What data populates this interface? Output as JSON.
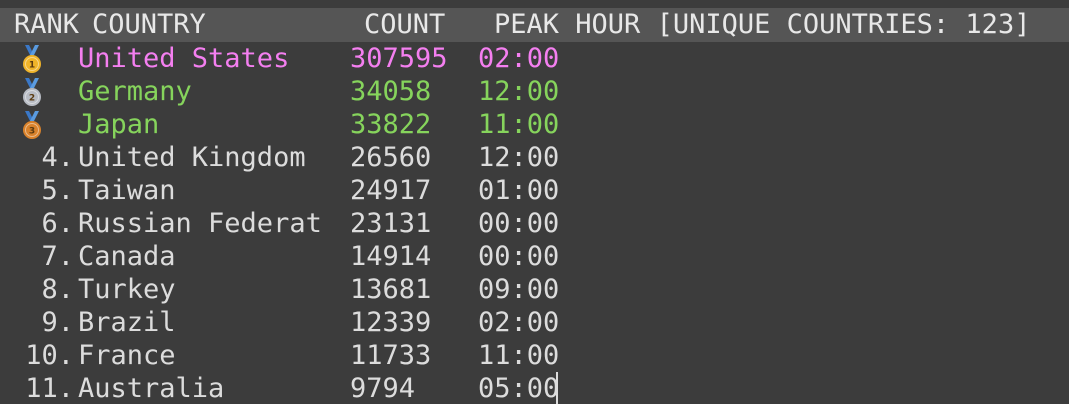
{
  "header": {
    "rank": "RANK",
    "country": "COUNTRY",
    "count": "COUNT",
    "peak_hour": "PEAK HOUR",
    "unique": "[UNIQUE COUNTRIES: 123]"
  },
  "colors": {
    "first_place": "#f47ff0",
    "podium": "#86d45c",
    "default_text": "#dcdcdc",
    "header_bg": "#555555",
    "terminal_bg": "#3c3c3c",
    "gold": "#f0b429",
    "silver": "#b8bcc4",
    "bronze": "#d9822b",
    "ribbon": "#3a78c8"
  },
  "rows": [
    {
      "rank": "",
      "medal": "gold-medal-icon",
      "medal_number": "1",
      "country": "United States",
      "count": "307595",
      "peak": "02:00"
    },
    {
      "rank": "",
      "medal": "silver-medal-icon",
      "medal_number": "2",
      "country": "Germany",
      "count": "34058",
      "peak": "12:00"
    },
    {
      "rank": "",
      "medal": "bronze-medal-icon",
      "medal_number": "3",
      "country": "Japan",
      "count": "33822",
      "peak": "11:00"
    },
    {
      "rank": "4.",
      "country": "United Kingdom",
      "count": "26560",
      "peak": "12:00"
    },
    {
      "rank": "5.",
      "country": "Taiwan",
      "count": "24917",
      "peak": "01:00"
    },
    {
      "rank": "6.",
      "country": "Russian Federat",
      "count": "23131",
      "peak": "00:00"
    },
    {
      "rank": "7.",
      "country": "Canada",
      "count": "14914",
      "peak": "00:00"
    },
    {
      "rank": "8.",
      "country": "Turkey",
      "count": "13681",
      "peak": "09:00"
    },
    {
      "rank": "9.",
      "country": "Brazil",
      "count": "12339",
      "peak": "02:00"
    },
    {
      "rank": "10.",
      "country": "France",
      "count": "11733",
      "peak": "11:00"
    },
    {
      "rank": "11.",
      "country": "Australia",
      "count": "9794",
      "peak": "05:00"
    }
  ]
}
